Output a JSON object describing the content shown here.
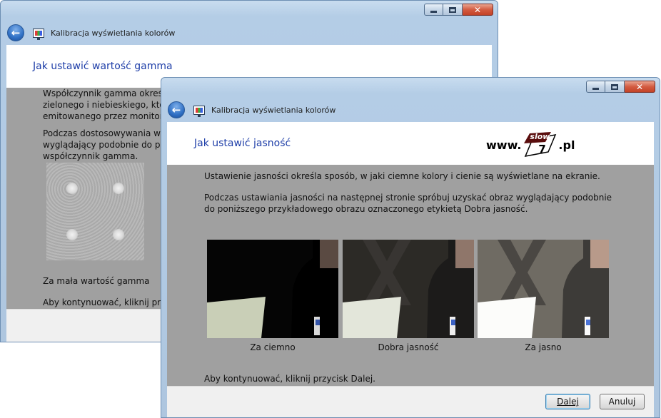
{
  "back_window": {
    "nav_title": "Kalibracja wyświetlania kolorów",
    "heading": "Jak ustawić wartość gamma",
    "paragraph1_lines": [
      "Współczynnik gamma określ",
      "zielonego i niebieskiego, któ",
      "emitowanego przez monitor"
    ],
    "paragraph2_lines": [
      "Podczas dostosowywania ws",
      "wyglądający podobnie do pe",
      "współczynnik gamma."
    ],
    "image_caption": "Za mała wartość gamma",
    "continue_text": "Aby kontynuować, kliknij przy"
  },
  "front_window": {
    "nav_title": "Kalibracja wyświetlania kolorów",
    "heading": "Jak ustawić jasność",
    "logo": {
      "prefix": "www.",
      "mark_top": "slow",
      "mark_bottom": "7",
      "suffix": ".pl"
    },
    "paragraph1": "Ustawienie jasności określa sposób, w jaki ciemne kolory i cienie są wyświetlane na ekranie.",
    "paragraph2_lines": [
      "Podczas ustawiania jasności na następnej stronie spróbuj uzyskać obraz wyglądający podobnie",
      "do poniższego przykładowego obrazu oznaczonego etykietą Dobra jasność."
    ],
    "samples": [
      {
        "label": "Za ciemno"
      },
      {
        "label": "Dobra jasność"
      },
      {
        "label": "Za jasno"
      }
    ],
    "continue_text": "Aby kontynuować, kliknij przycisk Dalej.",
    "buttons": {
      "next": "Dalej",
      "cancel": "Anuluj"
    }
  },
  "colors": {
    "heading": "#1e3ea8",
    "content_bg": "#a0a0a0",
    "close_button": "#c44226"
  }
}
